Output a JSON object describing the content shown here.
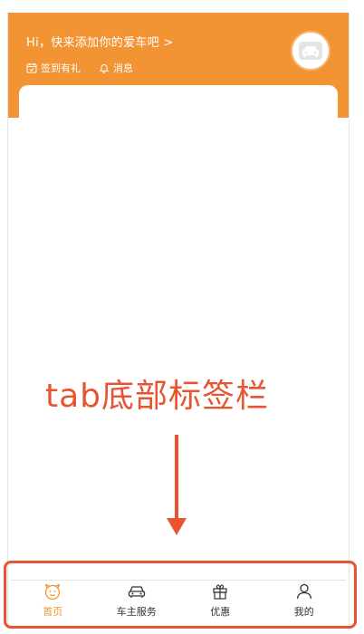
{
  "header": {
    "greeting": "Hi，快来添加你的爱车吧 >",
    "quick_links": [
      {
        "label": "签到有礼",
        "icon": "calendar-icon"
      },
      {
        "label": "消息",
        "icon": "bell-icon"
      }
    ],
    "avatar_icon": "car-avatar-icon"
  },
  "annotation": {
    "text": "tab底部标签栏"
  },
  "tabbar": {
    "tabs": [
      {
        "label": "首页",
        "icon": "home-icon",
        "active": true
      },
      {
        "label": "车主服务",
        "icon": "car-icon",
        "active": false
      },
      {
        "label": "优惠",
        "icon": "gift-icon",
        "active": false
      },
      {
        "label": "我的",
        "icon": "user-icon",
        "active": false
      }
    ]
  },
  "colors": {
    "accent": "#f39434",
    "annotation": "#e8542f"
  }
}
